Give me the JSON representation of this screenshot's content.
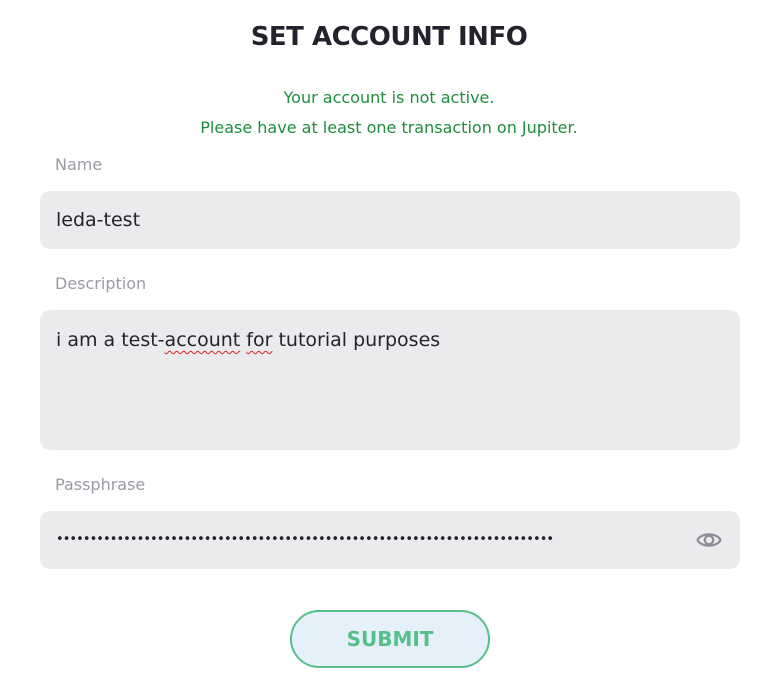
{
  "form": {
    "title": "SET ACCOUNT INFO",
    "notice_line1": "Your account is not active.",
    "notice_line2": "Please have at least one transaction on Jupiter.",
    "name_label": "Name",
    "name_value": "leda-test",
    "description_label": "Description",
    "description_prefix": "i am a test-",
    "description_word1": "account",
    "description_space": " ",
    "description_word2": "for",
    "description_suffix": " tutorial purposes",
    "passphrase_label": "Passphrase",
    "passphrase_masked": "••••••••••••••••••••••••••••••••••••••••••••••••••••••••••••••••••••••••••",
    "show_password_icon": "eye-icon",
    "submit_label": "SUBMIT"
  },
  "colors": {
    "title": "#23232d",
    "notice": "#1e8e3e",
    "label": "#9a9aa6",
    "field_bg": "#ebebed",
    "submit_border": "#57bf8a",
    "submit_bg": "#e6f0fb"
  }
}
